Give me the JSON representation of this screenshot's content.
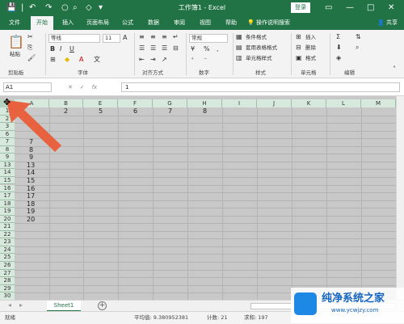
{
  "titlebar": {
    "title": "工作簿1 - Excel",
    "login": "登录",
    "qa_icons": [
      "save-icon",
      "undo-icon",
      "redo-icon",
      "circle-icon",
      "search-icon",
      "shape-icon",
      "dropdown-icon"
    ]
  },
  "tabs": [
    "文件",
    "开始",
    "插入",
    "页面布局",
    "公式",
    "数据",
    "审阅",
    "视图",
    "帮助"
  ],
  "active_tab": "开始",
  "tell_me": "操作说明搜索",
  "share": "共享",
  "ribbon": {
    "clipboard": {
      "paste": "粘贴",
      "label": "剪贴板"
    },
    "font": {
      "name": "等线",
      "size": "11",
      "label": "字体",
      "bold": "B",
      "italic": "I",
      "underline": "U"
    },
    "alignment": {
      "label": "对齐方式"
    },
    "number": {
      "format": "常规",
      "label": "数字",
      "percent": "%",
      "comma": ","
    },
    "styles": {
      "cond": "条件格式",
      "table": "套用表格格式",
      "cell": "单元格样式",
      "label": "样式"
    },
    "cells": {
      "insert": "插入",
      "delete": "删除",
      "format": "格式",
      "label": "单元格"
    },
    "editing": {
      "label": "编辑"
    }
  },
  "formula_bar": {
    "name_box": "A1",
    "fx": "fx",
    "value": "1"
  },
  "columns": [
    "A",
    "B",
    "E",
    "F",
    "G",
    "H",
    "I",
    "J",
    "K",
    "L",
    "M"
  ],
  "rows": [
    "1",
    "2",
    "3",
    "6",
    "7",
    "8",
    "9",
    "13",
    "14",
    "15",
    "16",
    "17",
    "18",
    "19",
    "20",
    "21",
    "22",
    "23",
    "24",
    "25",
    "26",
    "27",
    "28",
    "29",
    "30"
  ],
  "cells": {
    "r1_b": "2",
    "r1_e": "5",
    "r1_f": "6",
    "r1_g": "7",
    "r1_h": "8",
    "r7": "7",
    "r8": "8",
    "r9": "9",
    "r13": "13",
    "r14": "14",
    "r15": "15",
    "r16": "16",
    "r17": "17",
    "r18": "18",
    "r19": "19",
    "r20": "20"
  },
  "sheet": {
    "name": "Sheet1",
    "add": "+"
  },
  "status": {
    "ready": "就绪",
    "average": "平均值: 9.380952381",
    "count": "计数: 21",
    "sum": "求和: 197"
  },
  "watermark": {
    "brand": "纯净系统之家",
    "url": "www.ycwjzy.com"
  },
  "colors": {
    "excel_green": "#217346",
    "arrow": "#e8623f"
  }
}
